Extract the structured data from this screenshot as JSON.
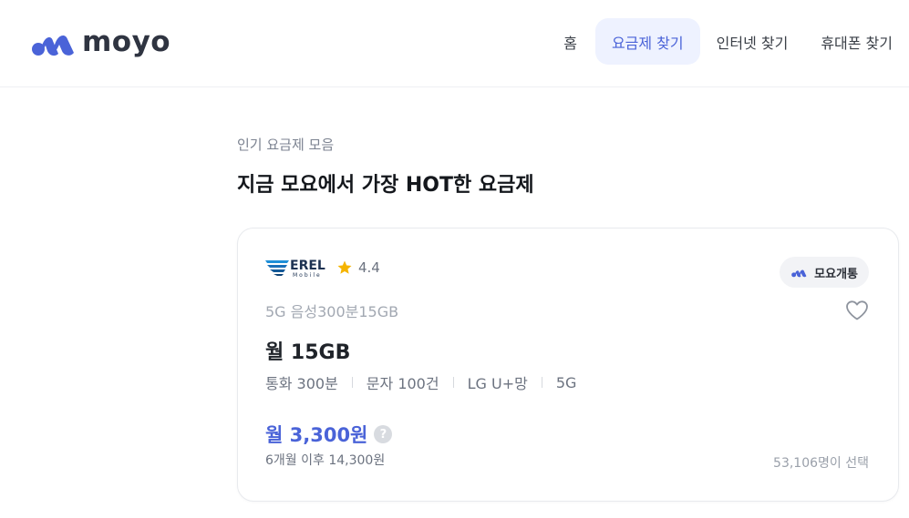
{
  "header": {
    "logo_text": "moyo",
    "brand_color": "#4a63d8",
    "nav": [
      {
        "label": "홈",
        "active": false
      },
      {
        "label": "요금제 찾기",
        "active": true
      },
      {
        "label": "인터넷 찾기",
        "active": false
      },
      {
        "label": "휴대폰 찾기",
        "active": false
      }
    ]
  },
  "section": {
    "subtitle": "인기 요금제 모음",
    "title": "지금 모요에서 가장 HOT한 요금제"
  },
  "card": {
    "mvno_logo_text": "EREL",
    "mvno_logo_subtext": "Mobile",
    "rating": "4.4",
    "badge_label": "모요개통",
    "plan_name": "5G 음성300분15GB",
    "data_amount": "월 15GB",
    "specs": [
      "통화 300분",
      "문자 100건",
      "LG U+망",
      "5G"
    ],
    "price": "월 3,300원",
    "price_after": "6개월 이후 14,300원",
    "selected_count": "53,106명이 선택",
    "price_color": "#4a63d8",
    "star_color": "#f5b400",
    "icons": [
      "moyo-logo-icon",
      "star-icon",
      "heart-icon",
      "help-icon"
    ]
  }
}
